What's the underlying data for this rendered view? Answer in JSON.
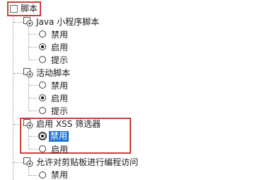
{
  "root": {
    "label": "脚本"
  },
  "groups": [
    {
      "label": "Java 小程序脚本",
      "options": [
        "禁用",
        "启用",
        "提示"
      ],
      "selected": 1
    },
    {
      "label": "活动脚本",
      "options": [
        "禁用",
        "启用",
        "提示"
      ],
      "selected": 1
    },
    {
      "label": "启用 XSS 筛选器",
      "options": [
        "禁用",
        "启用"
      ],
      "selected": 0
    },
    {
      "label": "允许对剪贴板进行编程访问",
      "options": [
        "禁用"
      ],
      "selected": -1
    }
  ],
  "colors": {
    "highlight_box": "#c9423c",
    "selection": "#1e73d8"
  },
  "icons": {
    "setting": "settings-gear-icon"
  }
}
